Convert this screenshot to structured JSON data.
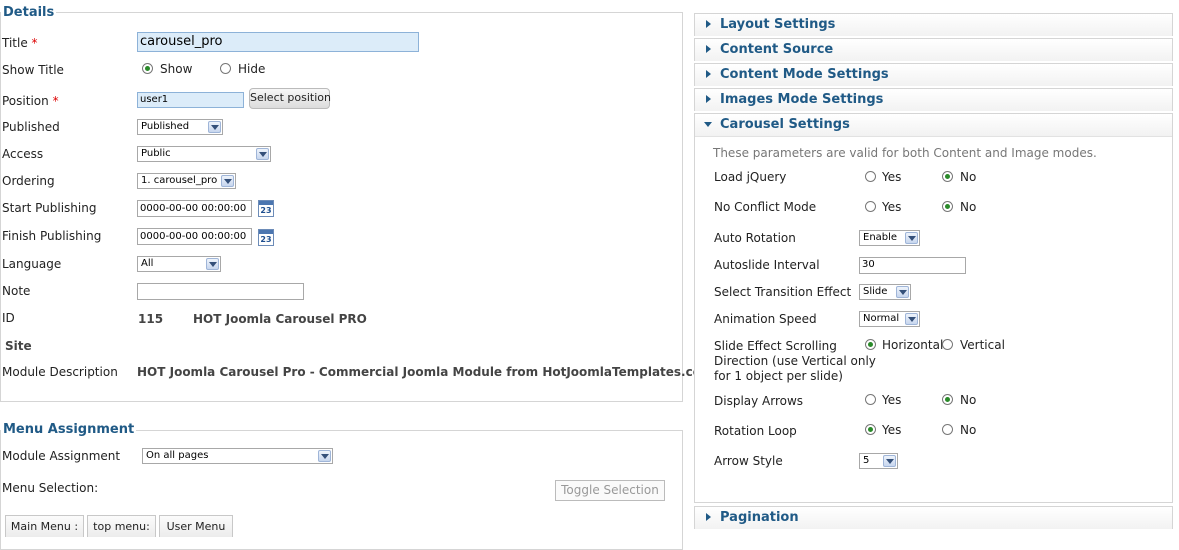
{
  "details": {
    "legend": "Details",
    "title_label": "Title",
    "required_mark": "*",
    "title_value": "carousel_pro",
    "show_title_label": "Show Title",
    "show_title_options": [
      "Show",
      "Hide"
    ],
    "show_title_selected": "Show",
    "position_label": "Position",
    "position_value": "user1",
    "select_position_button": "Select position",
    "published_label": "Published",
    "published_value": "Published",
    "access_label": "Access",
    "access_value": "Public",
    "ordering_label": "Ordering",
    "ordering_value": "1. carousel_pro",
    "start_publishing_label": "Start Publishing",
    "start_publishing_value": "0000-00-00 00:00:00",
    "finish_publishing_label": "Finish Publishing",
    "finish_publishing_value": "0000-00-00 00:00:00",
    "calendar_icon_text": "23",
    "language_label": "Language",
    "language_value": "All",
    "note_label": "Note",
    "note_value": "",
    "id_label": "ID",
    "id_value": "115",
    "id_name": "HOT Joomla Carousel PRO",
    "site_label": "Site",
    "module_description_label": "Module Description",
    "module_description_value": "HOT Joomla Carousel Pro - Commercial Joomla Module from HotJoomlaTemplates.com"
  },
  "menu_assignment": {
    "legend": "Menu Assignment",
    "module_assignment_label": "Module Assignment",
    "module_assignment_value": "On all pages",
    "menu_selection_label": "Menu Selection:",
    "toggle_selection_button": "Toggle Selection",
    "tabs": [
      "Main Menu :",
      "top menu:",
      "User Menu"
    ]
  },
  "panels": {
    "layout_settings": "Layout Settings",
    "content_source": "Content Source",
    "content_mode_settings": "Content Mode Settings",
    "images_mode_settings": "Images Mode Settings",
    "carousel_settings": "Carousel Settings",
    "pagination": "Pagination"
  },
  "carousel": {
    "note": "These parameters are valid for both Content and Image modes.",
    "load_jquery_label": "Load jQuery",
    "load_jquery_selected": "No",
    "no_conflict_label": "No Conflict Mode",
    "no_conflict_selected": "No",
    "auto_rotation_label": "Auto Rotation",
    "auto_rotation_value": "Enable",
    "autoslide_interval_label": "Autoslide Interval",
    "autoslide_interval_value": "30",
    "transition_effect_label": "Select Transition Effect",
    "transition_effect_value": "Slide",
    "animation_speed_label": "Animation Speed",
    "animation_speed_value": "Normal",
    "scrolling_direction_label_1": "Slide Effect Scrolling",
    "scrolling_direction_label_2": "Direction (use Vertical only",
    "scrolling_direction_label_3": "for 1 object per slide)",
    "scrolling_direction_options": [
      "Horizontal",
      "Vertical"
    ],
    "scrolling_direction_selected": "Horizontal",
    "display_arrows_label": "Display Arrows",
    "display_arrows_selected": "No",
    "rotation_loop_label": "Rotation Loop",
    "rotation_loop_selected": "Yes",
    "arrow_style_label": "Arrow Style",
    "arrow_style_value": "5",
    "yes_label": "Yes",
    "no_label": "No"
  }
}
